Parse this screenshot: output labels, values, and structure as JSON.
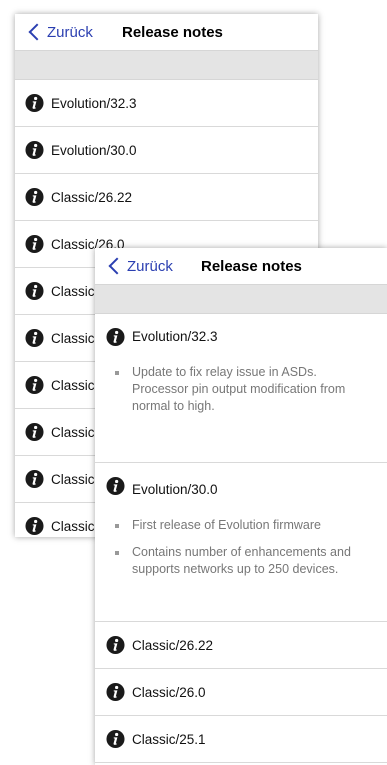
{
  "back_screen": {
    "nav": {
      "back_label": "Zurück",
      "title": "Release notes"
    },
    "items": [
      {
        "label": "Evolution/32.3"
      },
      {
        "label": "Evolution/30.0"
      },
      {
        "label": "Classic/26.22"
      },
      {
        "label": "Classic/26.0"
      },
      {
        "label": "Classic"
      },
      {
        "label": "Classic"
      },
      {
        "label": "Classic"
      },
      {
        "label": "Classic"
      },
      {
        "label": "Classic"
      },
      {
        "label": "Classic"
      }
    ]
  },
  "front_screen": {
    "nav": {
      "back_label": "Zurück",
      "title": "Release notes"
    },
    "expanded": [
      {
        "label": "Evolution/32.3",
        "notes": [
          "Update to fix relay issue in ASDs. Processor pin output modification from normal to high."
        ]
      },
      {
        "label": "Evolution/30.0",
        "notes": [
          "First release of Evolution firmware",
          "Contains number of enhancements and supports networks up to 250 devices."
        ]
      }
    ],
    "items": [
      {
        "label": "Classic/26.22"
      },
      {
        "label": "Classic/26.0"
      },
      {
        "label": "Classic/25.1"
      }
    ]
  },
  "colors": {
    "link": "#2b3fb1",
    "band": "#e4e4e4",
    "note_text": "#777777"
  },
  "icons": {
    "back": "chevron-left-icon",
    "info": "info-circle-icon"
  }
}
